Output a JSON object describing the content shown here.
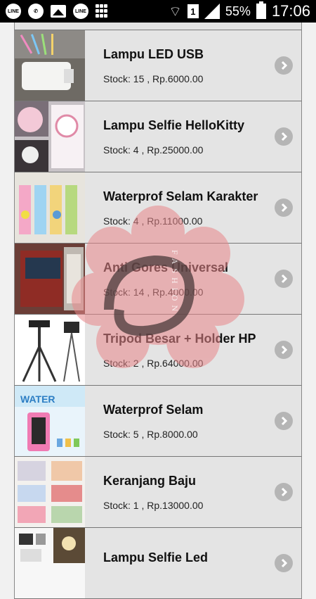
{
  "status_bar": {
    "battery": "55%",
    "time": "17:06",
    "sim": "1",
    "icons": [
      "line-icon",
      "whatsapp-icon",
      "gallery-icon",
      "line-icon",
      "bbm-icon"
    ]
  },
  "products": [
    {
      "name": "Lampu LED USB",
      "stock": "Stock: 15 , Rp.6000.00"
    },
    {
      "name": "Lampu Selfie HelloKitty",
      "stock": "Stock: 4 , Rp.25000.00"
    },
    {
      "name": "Waterprof Selam Karakter",
      "stock": "Stock: 4 , Rp.11000.00"
    },
    {
      "name": "Anti Gores Universal",
      "stock": "Stock: 14 , Rp.4000.00"
    },
    {
      "name": "Tripod Besar + Holder HP",
      "stock": "Stock: 2 , Rp.64000.00"
    },
    {
      "name": "Waterprof Selam",
      "stock": "Stock: 5 , Rp.8000.00"
    },
    {
      "name": "Keranjang Baju",
      "stock": "Stock: 1 , Rp.13000.00"
    },
    {
      "name": "Lampu Selfie Led",
      "stock": ""
    }
  ],
  "watermark": {
    "text": "FASHION",
    "colors": {
      "petals": "#e8878a",
      "arc": "#4a3a3a"
    }
  }
}
